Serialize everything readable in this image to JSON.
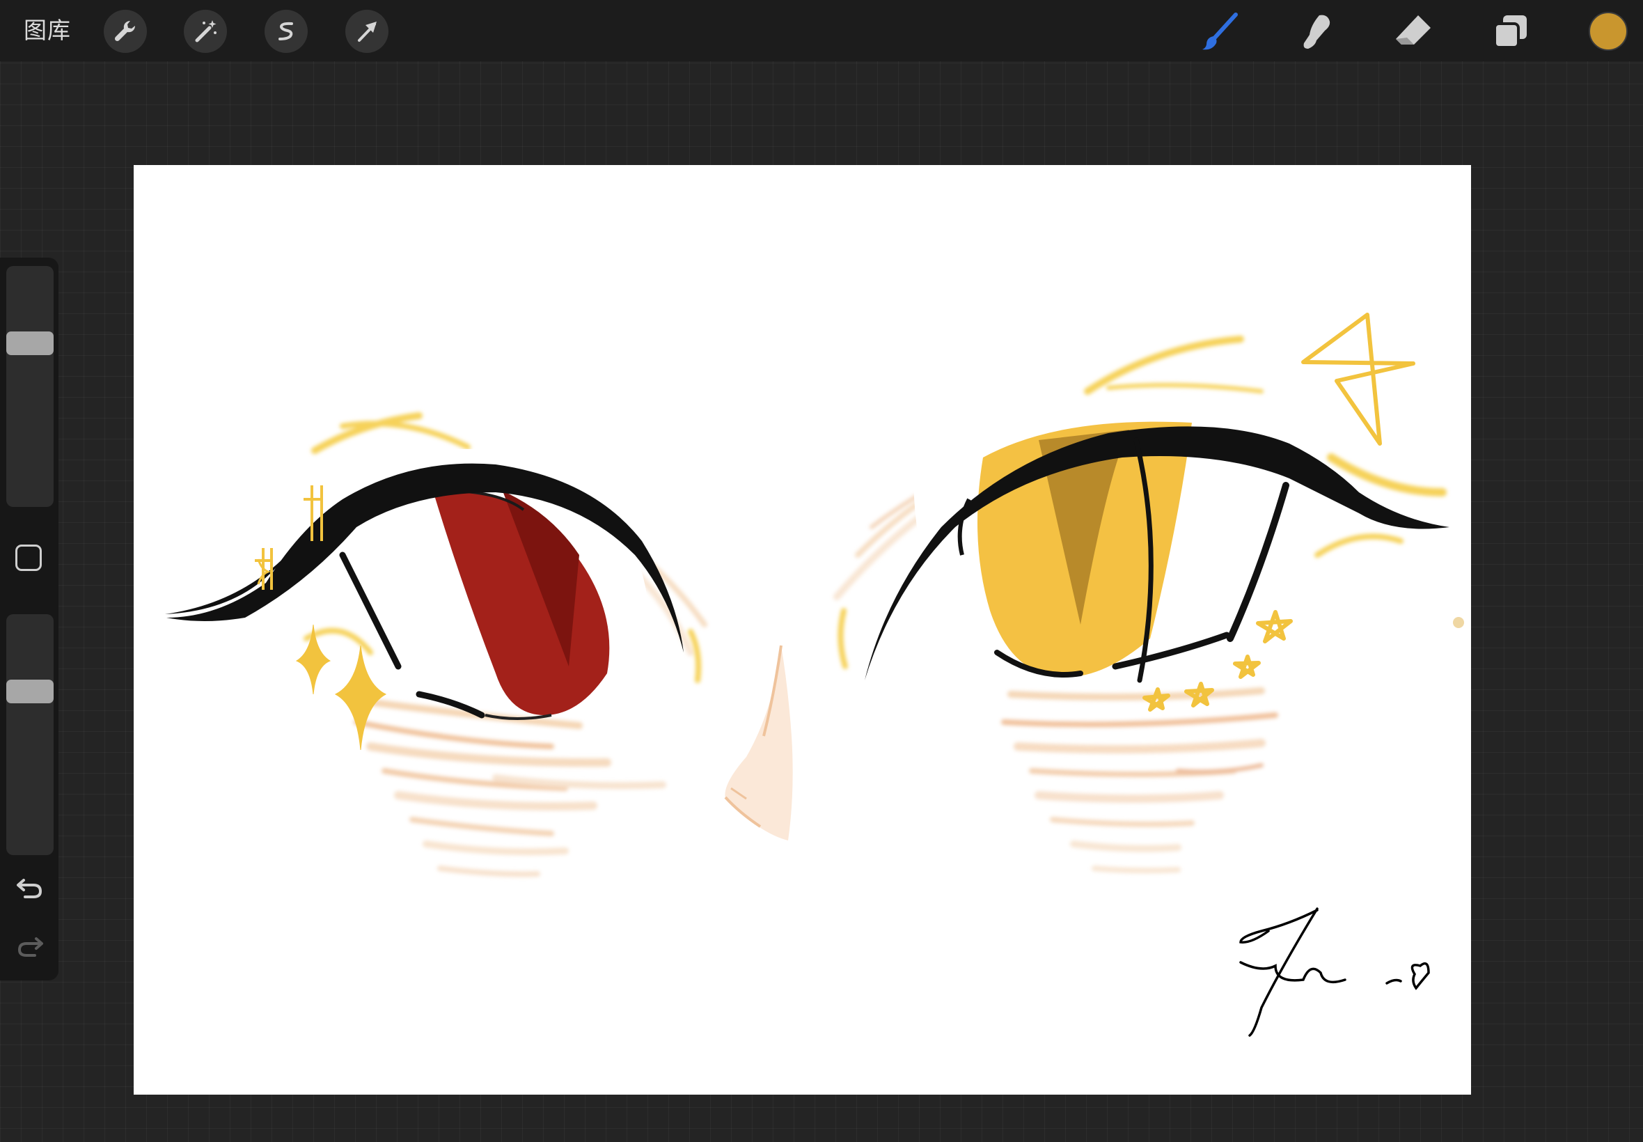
{
  "toolbar": {
    "gallery_label": "图库",
    "left_tools": [
      "wrench-icon",
      "magic-wand-icon",
      "selection-icon",
      "transform-arrow-icon"
    ],
    "right_tools": [
      "brush-icon",
      "smudge-icon",
      "eraser-icon",
      "layers-icon"
    ],
    "active_tool": "brush",
    "active_tool_color": "#2f6fe0",
    "current_color": "#c9962e"
  },
  "sidebar": {
    "brush_size_level": 0.3,
    "opacity_level": 0.3,
    "buttons": [
      "modify-square-icon",
      "undo-icon",
      "redo-icon"
    ],
    "redo_enabled": false
  },
  "artwork": {
    "left_iris_color": "#a3211a",
    "right_iris_color": "#f4c143",
    "sparkle_color": "#f2c33e",
    "blush_color": "#f2c9a8",
    "signature_color": "#000000"
  }
}
